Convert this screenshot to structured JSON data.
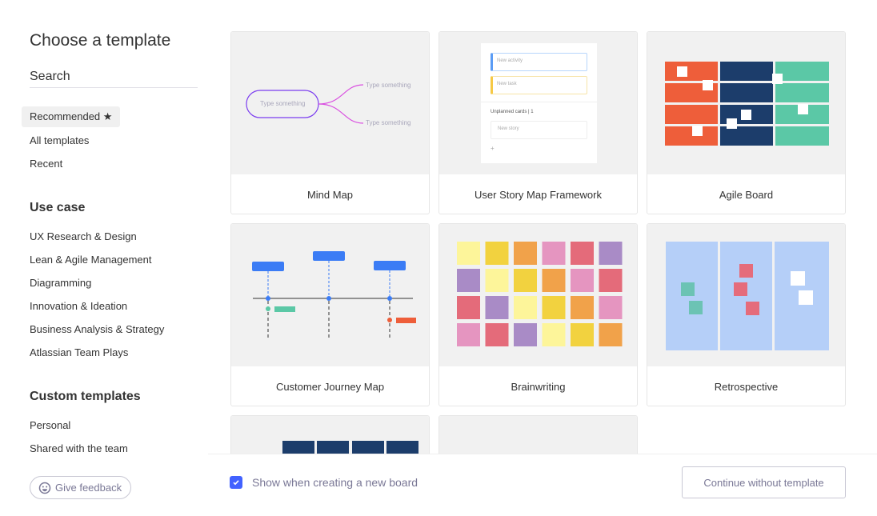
{
  "sidebar": {
    "title": "Choose a template",
    "search_placeholder": "Search",
    "nav": [
      {
        "label": "Recommended ★"
      },
      {
        "label": "All templates"
      },
      {
        "label": "Recent"
      }
    ],
    "use_case_heading": "Use case",
    "use_cases": [
      "UX Research & Design",
      "Lean & Agile Management",
      "Diagramming",
      "Innovation & Ideation",
      "Business Analysis & Strategy",
      "Atlassian Team Plays"
    ],
    "custom_heading": "Custom templates",
    "custom": [
      "Personal",
      "Shared with the team"
    ],
    "feedback_label": "Give feedback"
  },
  "templates": [
    {
      "label": "Mind Map",
      "thumb": {
        "center": "Type something",
        "branch1": "Type something",
        "branch2": "Type something"
      }
    },
    {
      "label": "User Story Map Framework",
      "thumb": {
        "activity": "New activity",
        "task": "New task",
        "unplanned": "Unplanned cards",
        "count": "1",
        "story": "New story",
        "add": "+"
      }
    },
    {
      "label": "Agile Board"
    },
    {
      "label": "Customer Journey Map"
    },
    {
      "label": "Brainwriting"
    },
    {
      "label": "Retrospective"
    },
    {
      "label": ""
    },
    {
      "label": ""
    }
  ],
  "footer": {
    "show_checkbox_checked": true,
    "show_label": "Show when creating a new board",
    "continue_label": "Continue without template"
  },
  "colors": {
    "accent": "#4262ff",
    "navy": "#1c3d6b",
    "orange": "#ee5e3a",
    "teal": "#5bc8a6"
  }
}
